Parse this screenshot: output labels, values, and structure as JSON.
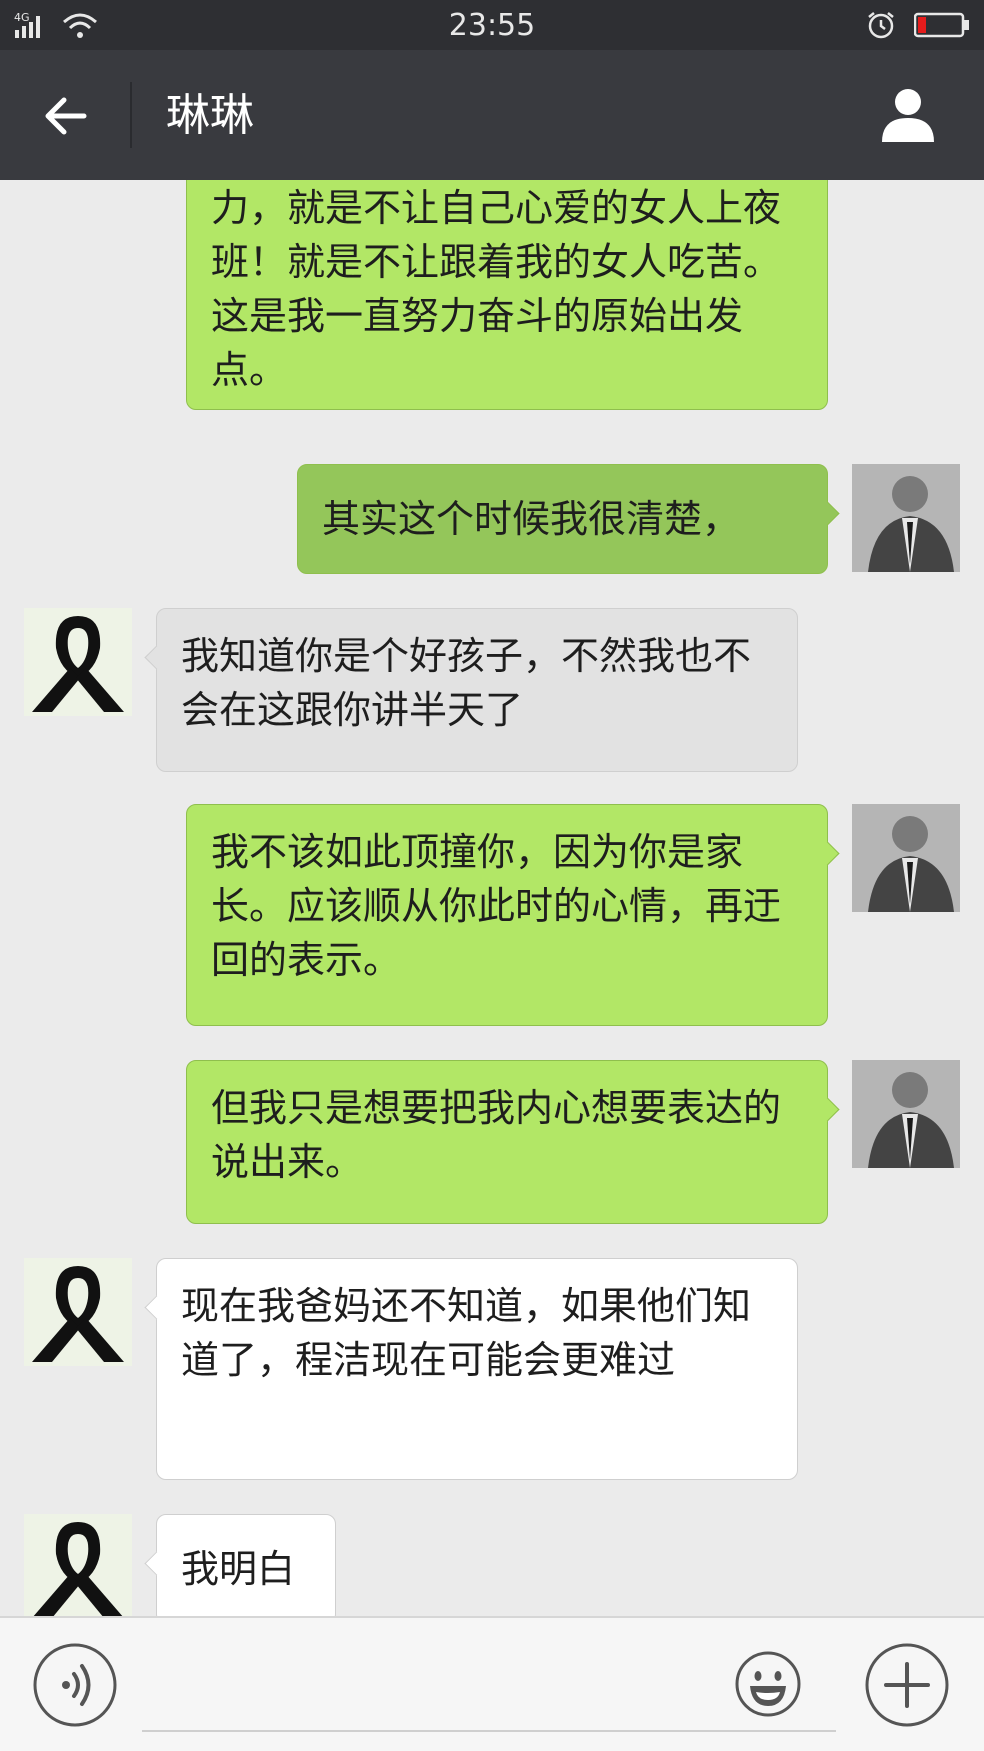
{
  "status_bar": {
    "time": "23:55",
    "network": "4G",
    "battery_color": "#e51c1c"
  },
  "header": {
    "title": "琳琳",
    "back_icon": "arrow-left-icon",
    "profile_icon": "person-icon"
  },
  "messages": [
    {
      "sender": "me",
      "text": "力，就是不让自己心爱的女人上夜班！就是不让跟着我的女人吃苦。这是我一直努力奋斗的原始出发点。"
    },
    {
      "sender": "me",
      "text": "其实这个时候我很清楚，",
      "pressed": true
    },
    {
      "sender": "them",
      "text": "我知道你是个好孩子，不然我也不会在这跟你讲半天了",
      "pressed": true
    },
    {
      "sender": "me",
      "text": "我不该如此顶撞你，因为你是家长。应该顺从你此时的心情，再迂回的表示。"
    },
    {
      "sender": "me",
      "text": "但我只是想要把我内心想要表达的说出来。"
    },
    {
      "sender": "them",
      "text": "现在我爸妈还不知道，如果他们知道了，程洁现在可能会更难过"
    },
    {
      "sender": "them",
      "text": "我明白"
    }
  ],
  "input_bar": {
    "voice_icon": "voice-icon",
    "emoji_icon": "emoji-icon",
    "plus_icon": "plus-icon",
    "input_value": ""
  },
  "colors": {
    "header_bg": "#393a3f",
    "status_bg": "#2e2f33",
    "chat_bg": "#ebebeb",
    "my_bubble": "#b2e766",
    "their_bubble": "#ffffff"
  }
}
